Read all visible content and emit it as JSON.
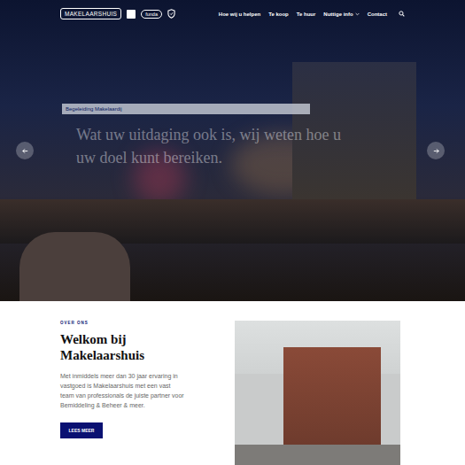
{
  "header": {
    "logo": "MAKELAARSHUIS",
    "badges": [
      "funda"
    ],
    "nav": [
      {
        "label": "Hoe wij u helpen",
        "has_dropdown": false
      },
      {
        "label": "Te koop",
        "has_dropdown": false
      },
      {
        "label": "Te huur",
        "has_dropdown": false
      },
      {
        "label": "Nuttige info",
        "has_dropdown": true
      },
      {
        "label": "Contact",
        "has_dropdown": false
      }
    ]
  },
  "hero": {
    "label": "Begeleiding Makelaardij",
    "headline": "Wat uw uitdaging ook is, wij weten hoe u uw doel kunt bereiken."
  },
  "about": {
    "eyebrow": "OVER ONS",
    "title": "Welkom bij Makelaarshuis",
    "text": "Met inmiddels meer dan 30 jaar ervaring in vastgoed is Makelaarshuis met een vast team van professionals de juiste partner voor Bemiddeling & Beheer & meer.",
    "button": "LEES MEER"
  }
}
